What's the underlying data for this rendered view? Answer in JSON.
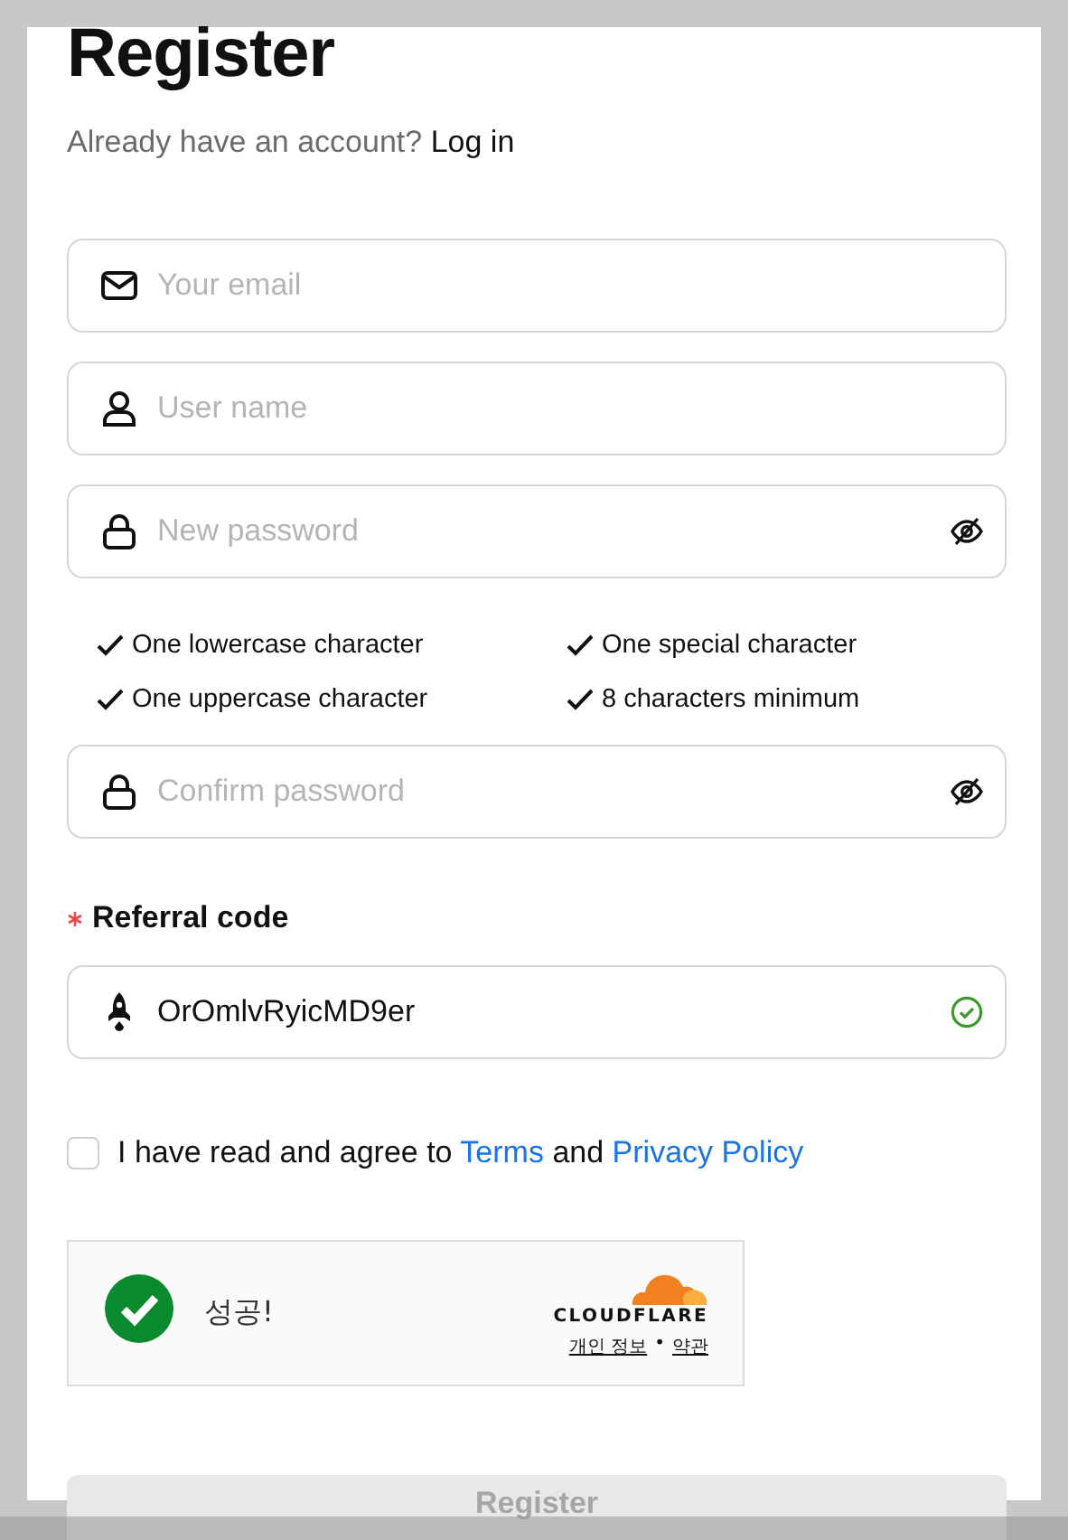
{
  "title": "Register",
  "login_prompt": {
    "text": "Already have an account?",
    "link": "Log in"
  },
  "fields": [
    {
      "kind": "email",
      "placeholder": "Your email"
    },
    {
      "kind": "user",
      "placeholder": "User name"
    },
    {
      "kind": "password",
      "placeholder": "New password",
      "reveal": true
    }
  ],
  "requirements": [
    {
      "label": "One lowercase character",
      "met": true
    },
    {
      "label": "One special character",
      "met": true
    },
    {
      "label": "One uppercase character",
      "met": true
    },
    {
      "label": "8 characters minimum",
      "met": true
    }
  ],
  "confirm_field": {
    "kind": "password",
    "placeholder": "Confirm password",
    "reveal": true
  },
  "referral": {
    "label": "Referral code",
    "required": true,
    "value": "OrOmlvRyicMD9er",
    "valid": true
  },
  "agreement": {
    "checked": false,
    "prefix": "I have read and agree to",
    "terms_link": "Terms",
    "middle": "and",
    "privacy_link": "Privacy Policy"
  },
  "captcha": {
    "status": "성공!",
    "success": true,
    "brand": "CLOUDFLARE",
    "privacy_link": "개인 정보",
    "separator": "•",
    "terms_link": "약관"
  },
  "submit": {
    "label": "Register",
    "disabled": true
  }
}
